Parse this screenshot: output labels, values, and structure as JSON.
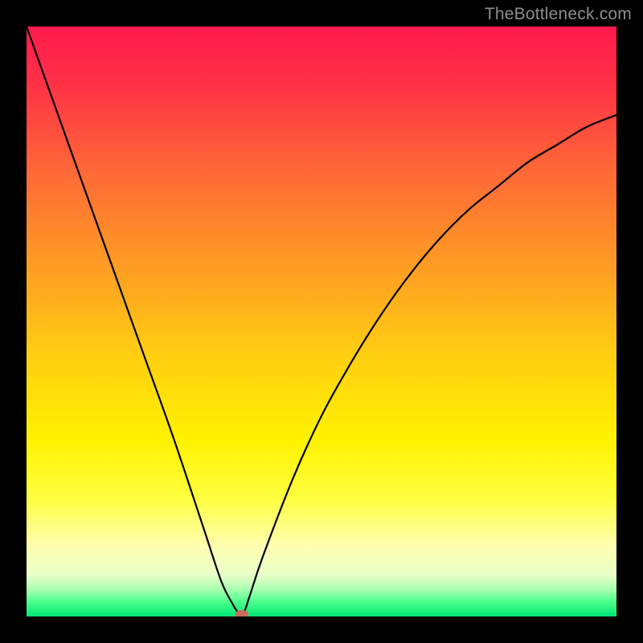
{
  "watermark": "TheBottleneck.com",
  "chart_data": {
    "type": "line",
    "title": "",
    "xlabel": "",
    "ylabel": "",
    "xlim": [
      0,
      100
    ],
    "ylim": [
      0,
      100
    ],
    "grid": false,
    "legend": false,
    "series": [
      {
        "name": "curve",
        "x": [
          0,
          5,
          10,
          15,
          20,
          25,
          30,
          33,
          35,
          36,
          36.5,
          37,
          38,
          40,
          45,
          50,
          55,
          60,
          65,
          70,
          75,
          80,
          85,
          90,
          95,
          100
        ],
        "y": [
          100,
          86,
          72,
          58,
          44,
          30,
          15,
          6,
          2,
          0.5,
          0.3,
          1,
          4,
          10,
          23,
          34,
          43,
          51,
          58,
          64,
          69,
          73,
          77,
          80,
          83,
          85
        ]
      }
    ],
    "marker": {
      "x": 36.5,
      "y": 0.3,
      "color": "#cc6a5f"
    },
    "gradient_stops": [
      {
        "offset": 0.0,
        "color": "#ff1a4c"
      },
      {
        "offset": 0.1,
        "color": "#ff3246"
      },
      {
        "offset": 0.25,
        "color": "#ff6a36"
      },
      {
        "offset": 0.4,
        "color": "#ff9a24"
      },
      {
        "offset": 0.55,
        "color": "#ffcc12"
      },
      {
        "offset": 0.7,
        "color": "#fff200"
      },
      {
        "offset": 0.8,
        "color": "#ffff40"
      },
      {
        "offset": 0.88,
        "color": "#ffffb0"
      },
      {
        "offset": 0.93,
        "color": "#e8ffc8"
      },
      {
        "offset": 0.955,
        "color": "#a6ffb0"
      },
      {
        "offset": 0.975,
        "color": "#4cff8c"
      },
      {
        "offset": 1.0,
        "color": "#00e676"
      }
    ]
  }
}
